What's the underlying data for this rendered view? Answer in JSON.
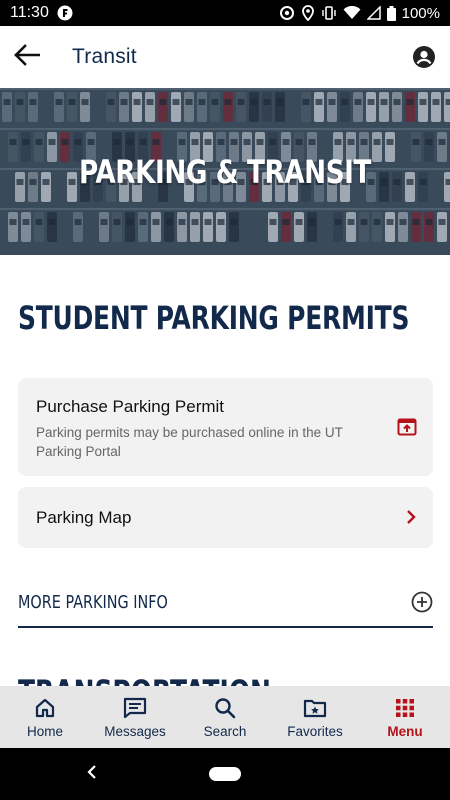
{
  "status_bar": {
    "time": "11:30",
    "battery": "100%"
  },
  "app_bar": {
    "title": "Transit"
  },
  "hero": {
    "title": "PARKING & TRANSIT"
  },
  "content": {
    "section_title": "STUDENT PARKING PERMITS",
    "cards": [
      {
        "title": "Purchase Parking Permit",
        "description": "Parking permits may be purchased online in the UT Parking Portal",
        "icon": "open-in-new-icon"
      },
      {
        "title": "Parking Map",
        "icon": "chevron-right-icon"
      }
    ],
    "more_label": "MORE PARKING INFO",
    "next_section_title": "TRANSPORTATION"
  },
  "bottom_nav": {
    "items": [
      {
        "label": "Home",
        "icon": "home-icon"
      },
      {
        "label": "Messages",
        "icon": "messages-icon"
      },
      {
        "label": "Search",
        "icon": "search-icon"
      },
      {
        "label": "Favorites",
        "icon": "favorites-folder-icon"
      },
      {
        "label": "Menu",
        "icon": "grid-menu-icon"
      }
    ],
    "active": "Menu"
  },
  "colors": {
    "brand_navy": "#13294b",
    "accent_red": "#b5121b",
    "card_bg": "#f2f2f2",
    "nav_bg": "#e6e6e6"
  }
}
